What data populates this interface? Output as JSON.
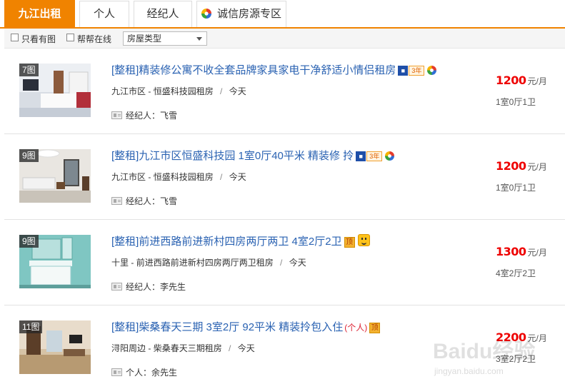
{
  "tabs": [
    {
      "label": "九江出租",
      "active": true
    },
    {
      "label": "个人",
      "active": false
    },
    {
      "label": "经纪人",
      "active": false
    },
    {
      "label": "诚信房源专区",
      "active": false,
      "icon": "chengxin-logo-icon"
    }
  ],
  "filters": {
    "only_with_photo": "只看有图",
    "helper_online": "帮帮在线",
    "house_type_select": "房屋类型"
  },
  "listings": [
    {
      "photo_count": "7图",
      "title": "[整租]精装修公寓不收全套品牌家具家电干净舒适小情侣租房",
      "badges": [
        "3年",
        "chengxin"
      ],
      "area": "九江市区 -",
      "community": "恒盛科技园租房",
      "time": "今天",
      "contact_label": "经纪人：",
      "contact_name": "飞雪",
      "price": "1200",
      "price_unit": "元/月",
      "rooms": "1室0厅1卫"
    },
    {
      "photo_count": "9图",
      "title": "[整租]九江市区恒盛科技园 1室0厅40平米 精装修 拎",
      "badges": [
        "3年",
        "chengxin"
      ],
      "area": "九江市区 -",
      "community": "恒盛科技园租房",
      "time": "今天",
      "contact_label": "经纪人：",
      "contact_name": "飞雪",
      "price": "1200",
      "price_unit": "元/月",
      "rooms": "1室0厅1卫"
    },
    {
      "photo_count": "9图",
      "title": "[整租]前进西路前进新村四房两厅两卫 4室2厅2卫",
      "badges": [
        "顶",
        "smile"
      ],
      "area": "十里 -",
      "community": "前进西路前进新村四房两厅两卫租房",
      "time": "今天",
      "contact_label": "经纪人：",
      "contact_name": "李先生",
      "price": "1300",
      "price_unit": "元/月",
      "rooms": "4室2厅2卫"
    },
    {
      "photo_count": "11图",
      "title": "[整租]柴桑春天三期 3室2厅 92平米 精装拎包入住",
      "personal_tag": "(个人)",
      "badges": [
        "顶"
      ],
      "area": "浔阳周边 -",
      "community": "柴桑春天三期租房",
      "time": "今天",
      "contact_label": "个人：",
      "contact_name": "余先生",
      "price": "2200",
      "price_unit": "元/月",
      "rooms": "3室2厅2卫"
    }
  ],
  "watermark": {
    "text": "Baidu经验",
    "url": "jingyan.baidu.com"
  },
  "colors": {
    "accent": "#f08300",
    "link": "#2a62b2",
    "price": "#e00000"
  }
}
